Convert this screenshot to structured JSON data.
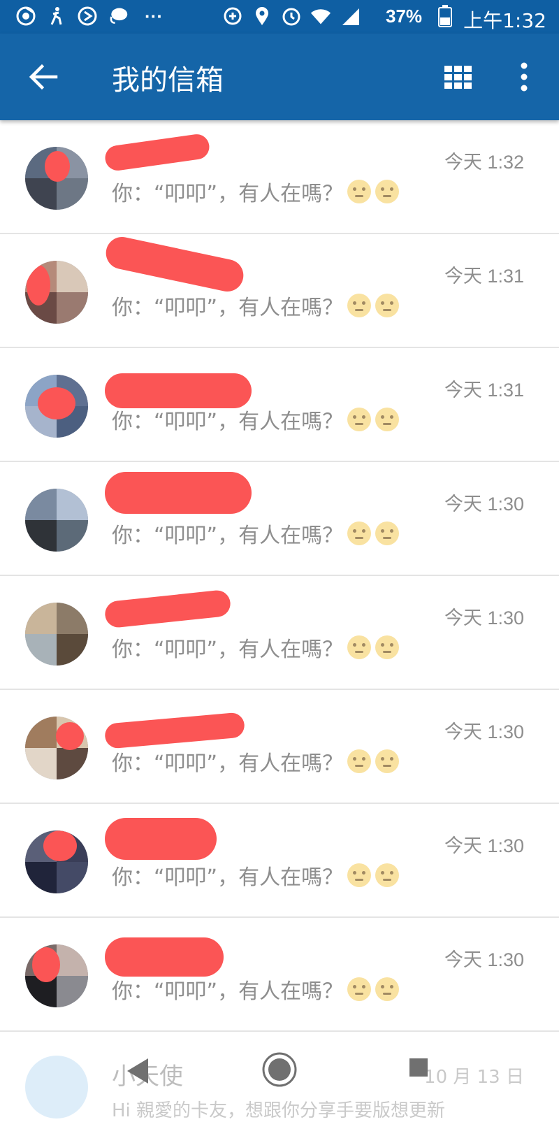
{
  "status_bar": {
    "battery": "37%",
    "time": "上午1:32",
    "icons": [
      "chrome-icon",
      "accessibility-icon",
      "maps-navigation-icon",
      "chat-bubble-icon",
      "more-dots-icon",
      "data-saver-icon",
      "location-icon",
      "alarm-icon",
      "wifi-icon",
      "signal-icon",
      "battery-charging-icon"
    ],
    "more": "···"
  },
  "app_bar": {
    "title": "我的信箱",
    "color": "#1565a8"
  },
  "messages": [
    {
      "preview": "你：“叩叩”，有人在嗎？",
      "time": "今天 1:32"
    },
    {
      "preview": "你：“叩叩”，有人在嗎？",
      "time": "今天 1:31"
    },
    {
      "preview": "你：“叩叩”，有人在嗎？",
      "time": "今天 1:31"
    },
    {
      "preview": "你：“叩叩”，有人在嗎？",
      "time": "今天 1:30"
    },
    {
      "preview": "你：“叩叩”，有人在嗎？",
      "time": "今天 1:30"
    },
    {
      "preview": "你：“叩叩”，有人在嗎？",
      "time": "今天 1:30"
    },
    {
      "preview": "你：“叩叩”，有人在嗎？",
      "time": "今天 1:30"
    },
    {
      "preview": "你：“叩叩”，有人在嗎？",
      "time": "今天 1:30"
    }
  ],
  "partial_row": {
    "name": "小天使",
    "date": "10 月 13 日",
    "preview": "Hi 親愛的卡友，想跟你分享手要版想更新"
  },
  "redaction_color": "#fb5555"
}
